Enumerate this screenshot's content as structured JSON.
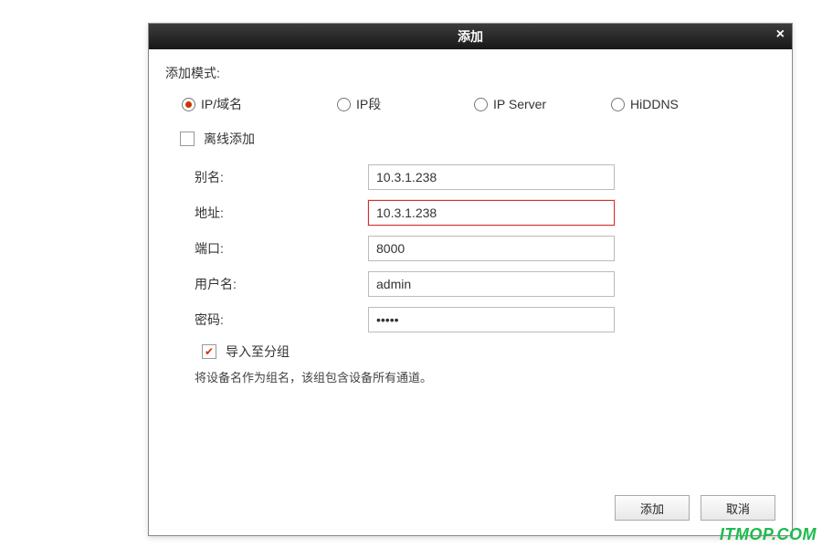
{
  "dialog": {
    "title": "添加",
    "mode_label": "添加模式:",
    "radios": {
      "ip_domain": "IP/域名",
      "ip_segment": "IP段",
      "ip_server": "IP Server",
      "hiddns": "HiDDNS"
    },
    "offline_label": "离线添加",
    "fields": {
      "alias_label": "别名:",
      "alias_value": "10.3.1.238",
      "address_label": "地址:",
      "address_value": "10.3.1.238",
      "port_label": "端口:",
      "port_value": "8000",
      "user_label": "用户名:",
      "user_value": "admin",
      "password_label": "密码:",
      "password_value": "•••••"
    },
    "import_label": "导入至分组",
    "hint": "将设备名作为组名，该组包含设备所有通道。",
    "buttons": {
      "ok": "添加",
      "cancel": "取消"
    }
  },
  "watermark": "ITMOP.COM"
}
